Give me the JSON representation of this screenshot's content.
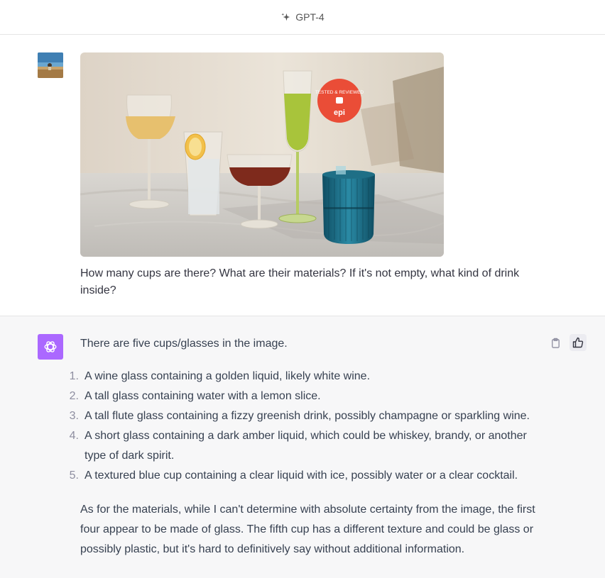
{
  "header": {
    "model_label": "GPT-4",
    "icon": "sparkle-icon"
  },
  "user_message": {
    "avatar": "user-avatar-photo",
    "image": {
      "badge_line1": "TESTED & REVIEWED",
      "badge_brand": "epi"
    },
    "text": "How many cups are there? What are their materials? If it's not empty, what kind of drink inside?"
  },
  "assistant_message": {
    "avatar": "openai-logo-icon",
    "intro": "There are five cups/glasses in the image.",
    "items": [
      {
        "num": "1.",
        "text": "A wine glass containing a golden liquid, likely white wine."
      },
      {
        "num": "2.",
        "text": "A tall glass containing water with a lemon slice."
      },
      {
        "num": "3.",
        "text": "A tall flute glass containing a fizzy greenish drink, possibly champagne or sparkling wine."
      },
      {
        "num": "4.",
        "text": "A short glass containing a dark amber liquid, which could be whiskey, brandy, or another type of dark spirit."
      },
      {
        "num": "5.",
        "text": "A textured blue cup containing a clear liquid with ice, possibly water or a clear cocktail."
      }
    ],
    "outro": "As for the materials, while I can't determine with absolute certainty from the image, the first four appear to be made of glass. The fifth cup has a different texture and could be glass or possibly plastic, but it's hard to definitively say without additional information.",
    "actions": {
      "copy_icon": "clipboard-icon",
      "like_icon": "thumbs-up-icon"
    }
  }
}
